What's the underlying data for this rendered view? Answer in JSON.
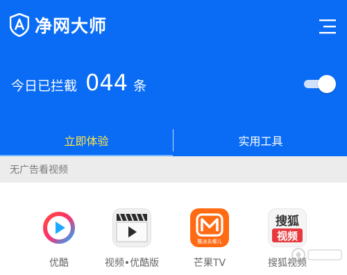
{
  "app": {
    "title": "净网大师"
  },
  "header": {
    "blocked_label": "今日已拦截",
    "blocked_count": "044",
    "blocked_unit": "条",
    "toggle_on": true,
    "menu_icon": "hamburger-menu-icon"
  },
  "tabs": [
    {
      "label": "立即体验",
      "active": true
    },
    {
      "label": "实用工具",
      "active": false
    }
  ],
  "section": {
    "title": "无广告看视频"
  },
  "apps": [
    {
      "label": "优酷",
      "icon": "youku-icon"
    },
    {
      "label": "视频•优酷版",
      "icon": "video-player-icon"
    },
    {
      "label": "芒果TV",
      "icon": "mango-tv-icon"
    },
    {
      "label": "搜狐视频",
      "icon": "sohu-video-icon"
    }
  ],
  "icon_texts": {
    "mango_caption": "酷派去哪儿",
    "sohu_top": "搜狐",
    "sohu_bottom": "视频"
  },
  "colors": {
    "header_bg": "#0a6cf5",
    "active_tab": "#ffe54a",
    "section_bg": "#ececec",
    "label_text": "#666666"
  }
}
